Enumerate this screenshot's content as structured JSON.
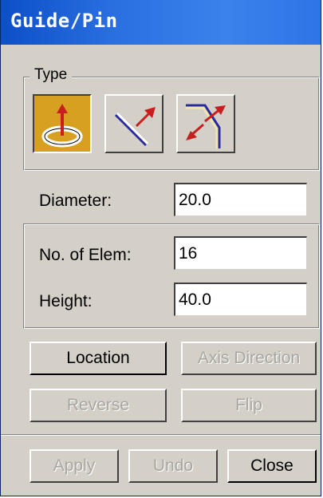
{
  "window": {
    "title": "Guide/Pin"
  },
  "type_group": {
    "legend": "Type",
    "tools": [
      {
        "name": "pin",
        "icon": "pin-ring-icon",
        "active": true
      },
      {
        "name": "guide-line",
        "icon": "guide-line-icon",
        "active": false
      },
      {
        "name": "guide-bent",
        "icon": "guide-bent-icon",
        "active": false
      }
    ]
  },
  "diameter": {
    "label": "Diameter:",
    "value": "20.0"
  },
  "elem_group": {
    "no_of_elem": {
      "label": "No. of Elem:",
      "value": "16"
    },
    "height": {
      "label": "Height:",
      "value": "40.0"
    }
  },
  "actions": {
    "location": "Location",
    "axis_direction": "Axis Direction",
    "reverse": "Reverse",
    "flip": "Flip"
  },
  "footer": {
    "apply": "Apply",
    "undo": "Undo",
    "close": "Close"
  },
  "colors": {
    "title_bar": "#2a6fe0",
    "active_tool": "#d8a020",
    "face": "#d4d0c8"
  }
}
